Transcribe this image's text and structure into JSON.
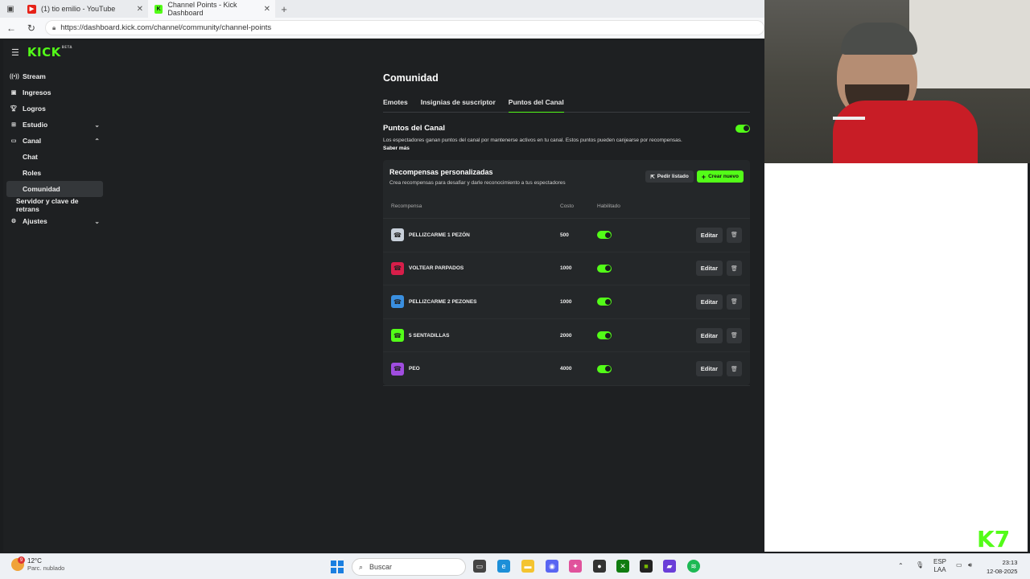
{
  "browser": {
    "tabs": [
      {
        "label": "(1) tio emilio - YouTube",
        "fav_color": "#e62117"
      },
      {
        "label": "Channel Points - Kick Dashboard",
        "fav_color": "#53fc18"
      }
    ],
    "url": "https://dashboard.kick.com/channel/community/channel-points"
  },
  "sidebar": {
    "logo": "KICK",
    "logo_badge": "BETA",
    "items": [
      {
        "label": "Stream",
        "icon": "broadcast-icon"
      },
      {
        "label": "Ingresos",
        "icon": "wallet-icon"
      },
      {
        "label": "Logros",
        "icon": "trophy-icon"
      },
      {
        "label": "Estudio",
        "icon": "studio-icon"
      },
      {
        "label": "Canal",
        "icon": "channel-icon"
      },
      {
        "label": "Chat"
      },
      {
        "label": "Roles"
      },
      {
        "label": "Comunidad"
      },
      {
        "label": "Servidor y clave de retrans"
      },
      {
        "label": "Ajustes",
        "icon": "gear-icon"
      }
    ]
  },
  "page": {
    "title": "Comunidad",
    "tabs": [
      "Emotes",
      "Insignias de suscriptor",
      "Puntos del Canal"
    ],
    "section_title": "Puntos del Canal",
    "section_desc": "Los espectadores ganan puntos del canal por mantenerse activos en tu canal. Estos puntos pueden canjearse por recompensas.",
    "learn_more": "Saber más",
    "enabled": true
  },
  "rewards": {
    "title": "Recompensas personalizadas",
    "subtitle": "Crea recompensas para desafiar y darle reconocimiento a tus espectadores",
    "request_list": "Pedir listado",
    "create_new": "Crear nuevo",
    "columns": [
      "Recompensa",
      "Costo",
      "Habilitado"
    ],
    "edit_label": "Editar",
    "items": [
      {
        "name": "PELLIZCARME 1 PEZÓN",
        "cost": "500",
        "enabled": true,
        "color": "#c8d0da"
      },
      {
        "name": "VOLTEAR PARPADOS",
        "cost": "1000",
        "enabled": true,
        "color": "#d81e4a"
      },
      {
        "name": "PELLIZCARME 2 PEZONES",
        "cost": "1000",
        "enabled": true,
        "color": "#3a8fe0"
      },
      {
        "name": "5 SENTADILLAS",
        "cost": "2000",
        "enabled": true,
        "color": "#53fc18"
      },
      {
        "name": "PEO",
        "cost": "4000",
        "enabled": true,
        "color": "#a04de0"
      }
    ]
  },
  "overlay": {
    "brand": "K",
    "number": "7"
  },
  "taskbar": {
    "temp": "12°C",
    "weather": "Parc. nublado",
    "weather_badge": "9",
    "search": "Buscar",
    "lang1": "ESP",
    "lang2": "LAA",
    "time": "23:13",
    "date": "12-08-2025"
  }
}
